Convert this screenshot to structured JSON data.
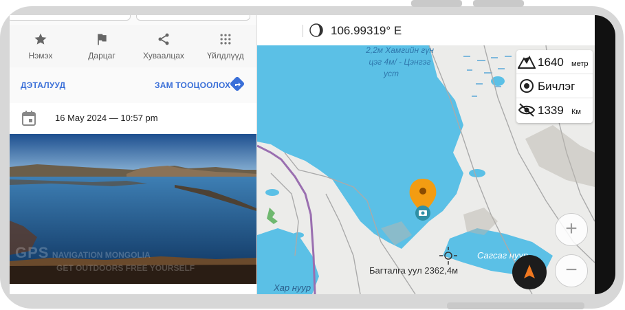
{
  "actions": [
    {
      "icon": "star-icon",
      "label": "Нэмэх"
    },
    {
      "icon": "flag-icon",
      "label": "Дарцаг"
    },
    {
      "icon": "share-icon",
      "label": "Хуваалцах"
    },
    {
      "icon": "grid-icon",
      "label": "Үйлдлүүд"
    }
  ],
  "links": {
    "details": "ДЭТАЛУУД",
    "route": "ЗАМ ТООЦООЛОХ"
  },
  "date_text": "16 May 2024 — 10:57 pm",
  "photo": {
    "watermark_big": "GPS",
    "watermark_title": "NAVIGATION MONGOLIA",
    "watermark_sub": "GET OUTDOORS FREE YOURSELF"
  },
  "coords": {
    "longitude": "106.99319° E"
  },
  "info": {
    "elevation_value": "1640",
    "elevation_unit": "метр",
    "mode_label": "Бичлэг",
    "distance_value": "1339",
    "distance_unit": "Км"
  },
  "map_labels": {
    "lake_note_1": "2,2м Хамгийн гүн",
    "lake_note_2": "цэг 4м/ - Цэнгэг",
    "lake_note_3": "уст",
    "peak": "Багталга уул 2362,4м",
    "lake_east": "Сагсаг нуур",
    "lake_south": "Хар нуур"
  },
  "zoom": {
    "in": "+",
    "out": "−"
  },
  "colors": {
    "water": "#5bc0e6",
    "land": "#ececea",
    "accent": "#3a6fd8",
    "marker": "#f39c12",
    "compass_arrow": "#f07820"
  }
}
